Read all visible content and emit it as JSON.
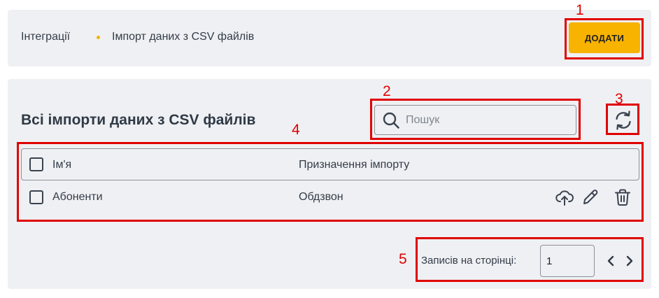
{
  "breadcrumb": {
    "parent": "Інтеграції",
    "current": "Імпорт даних з CSV файлів"
  },
  "header": {
    "add_button_label": "ДОДАТИ"
  },
  "main": {
    "title": "Всі імпорти даних з CSV файлів",
    "search": {
      "placeholder": "Пошук",
      "value": ""
    },
    "table": {
      "columns": [
        "Ім'я",
        "Призначення імпорту"
      ],
      "rows": [
        {
          "name": "Абоненти",
          "purpose": "Обдзвон"
        }
      ]
    },
    "pagination": {
      "label": "Записів на сторінці:",
      "per_page": "1"
    }
  },
  "annotations": [
    "1",
    "2",
    "3",
    "4",
    "5"
  ],
  "colors": {
    "accent": "#f8b300",
    "card_bg": "#eff0f3",
    "annotation": "#e00000",
    "text": "#333c48"
  },
  "icons": [
    "search-icon",
    "refresh-icon",
    "upload-icon",
    "edit-icon",
    "delete-icon",
    "chevron-left-icon",
    "chevron-right-icon"
  ]
}
